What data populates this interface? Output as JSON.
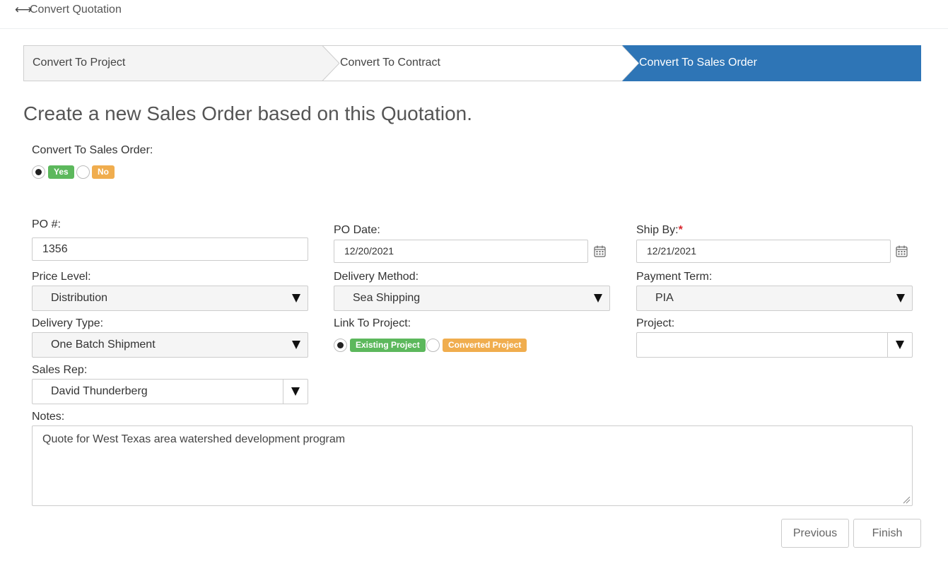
{
  "header": {
    "title": "Convert Quotation",
    "icon": "left-right-arrow-icon"
  },
  "wizard": {
    "steps": [
      {
        "label": "Convert To Project",
        "state": "completed"
      },
      {
        "label": "Convert To Contract",
        "state": "inactive"
      },
      {
        "label": "Convert To Sales Order",
        "state": "active"
      }
    ],
    "active_color": "#2e75b6"
  },
  "heading": "Create a new Sales Order based on this Quotation.",
  "convert": {
    "label": "Convert To Sales Order:",
    "yes_label": "Yes",
    "no_label": "No",
    "selected": "Yes"
  },
  "form": {
    "po_number": {
      "label": "PO #:",
      "value": "1356"
    },
    "po_date": {
      "label": "PO Date:",
      "value": "12/20/2021"
    },
    "ship_by": {
      "label": "Ship By:",
      "required_mark": "*",
      "value": "12/21/2021"
    },
    "price_level": {
      "label": "Price Level:",
      "value": "Distribution"
    },
    "delivery_method": {
      "label": "Delivery Method:",
      "value": "Sea Shipping"
    },
    "payment_term": {
      "label": "Payment Term:",
      "value": "PIA"
    },
    "delivery_type": {
      "label": "Delivery Type:",
      "value": "One Batch Shipment"
    },
    "link_to_project": {
      "label": "Link To Project:",
      "existing_label": "Existing Project",
      "converted_label": "Converted Project",
      "selected": "Existing Project"
    },
    "project": {
      "label": "Project:",
      "value": ""
    },
    "sales_rep": {
      "label": "Sales Rep:",
      "value": "David Thunderberg"
    },
    "notes": {
      "label": "Notes:",
      "value": "Quote for West Texas area watershed development program"
    }
  },
  "footer": {
    "previous_label": "Previous",
    "finish_label": "Finish"
  },
  "colors": {
    "yes_badge": "#5cb85c",
    "no_badge": "#f0ad4e",
    "required": "#d9272e"
  }
}
